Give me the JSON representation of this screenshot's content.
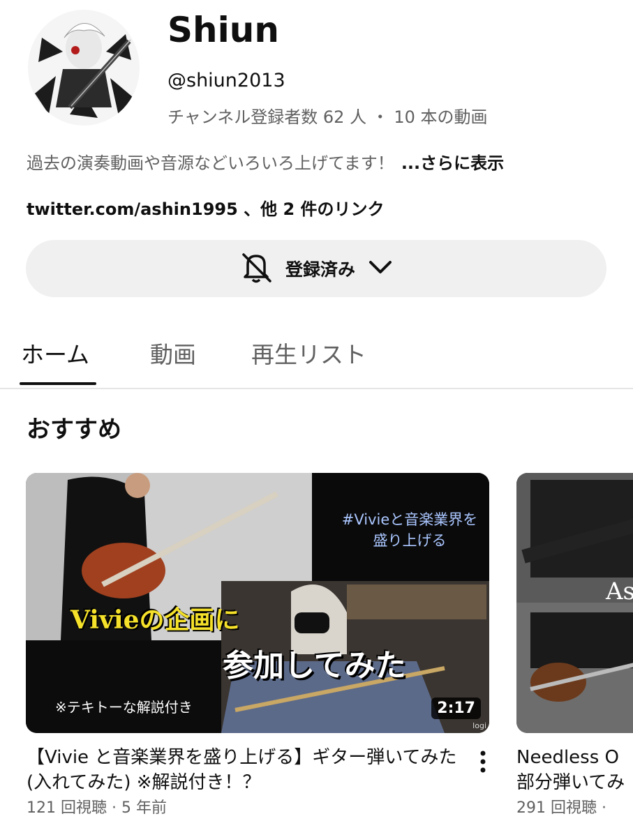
{
  "channel": {
    "name": "Shiun",
    "handle": "@shiun2013",
    "stats": "チャンネル登録者数 62 人 ・ 10 本の動画",
    "description": "過去の演奏動画や音源などいろいろ上げてます！",
    "description_more": "...さらに表示",
    "links": "twitter.com/ashin1995 、他 2 件のリンク"
  },
  "subscribe": {
    "label": "登録済み",
    "icon": "bell-off-icon"
  },
  "tabs": [
    {
      "label": "ホーム",
      "active": true
    },
    {
      "label": "動画",
      "active": false
    },
    {
      "label": "再生リスト",
      "active": false
    }
  ],
  "section": {
    "title": "おすすめ"
  },
  "videos": [
    {
      "thumb_text_1": "#Vivieと音楽業界を\n盛り上げる",
      "thumb_text_2": "Vivieの企画に",
      "thumb_text_3": "参加してみた",
      "thumb_text_4": "※テキトーな解説付き",
      "thumb_logo": "logi",
      "duration": "2:17",
      "title": "【Vivie と音楽業界を盛り上げる】ギター弾いてみた (入れてみた) ※解説付き！？",
      "meta": "121 回視聴 · 5 年前"
    },
    {
      "thumb_text_1": "As",
      "title": "Needless O\n部分弾いてみ",
      "meta": "291 回視聴 ·"
    }
  ]
}
